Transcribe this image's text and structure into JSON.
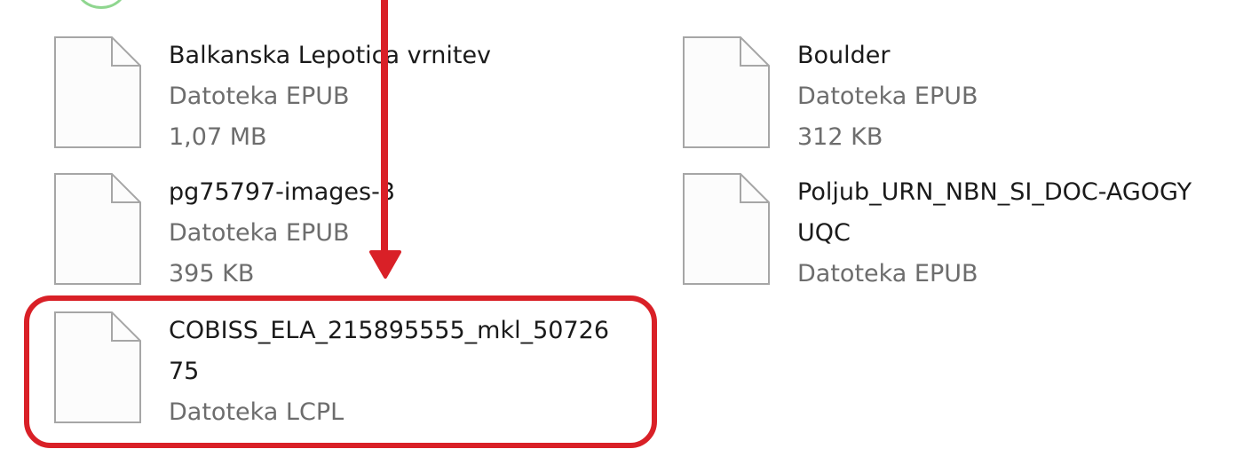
{
  "files": [
    {
      "name": "Balkanska Lepotica vrnitev",
      "type": "Datoteka EPUB",
      "size": "1,07 MB"
    },
    {
      "name": "Boulder",
      "type": "Datoteka EPUB",
      "size": "312 KB"
    },
    {
      "name": "pg75797-images-3",
      "type": "Datoteka EPUB",
      "size": "395 KB"
    },
    {
      "name": "Poljub_URN_NBN_SI_DOC-AGOGY",
      "name_line2": "UQC",
      "type": "Datoteka EPUB"
    },
    {
      "name": "COBISS_ELA_215895555_mkl_50726",
      "name_line2": "75",
      "type": "Datoteka LCPL"
    }
  ],
  "annotation": {
    "highlight_color": "#d92027",
    "arrow_color": "#d92027",
    "highlighted_file_index": 4
  },
  "colors": {
    "filename_text": "#1a1a1a",
    "meta_text": "#6d6d6d",
    "icon_stroke": "#a6a6a6",
    "icon_fill": "#fcfcfc"
  }
}
